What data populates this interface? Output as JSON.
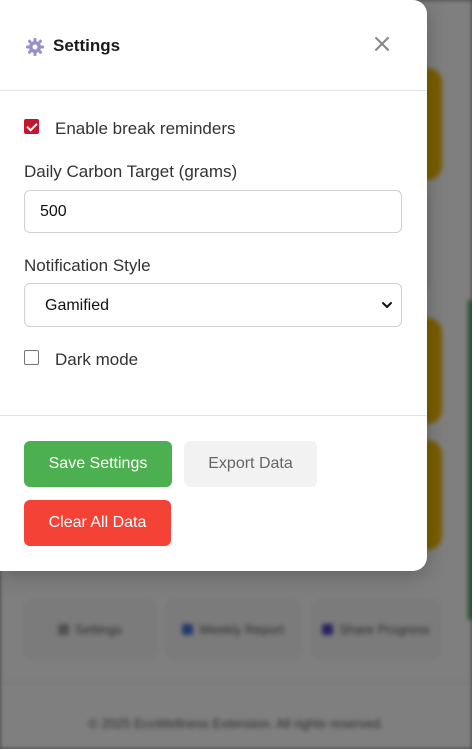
{
  "background": {
    "tiles": [
      {
        "label": "Settings",
        "icon": "gear-icon"
      },
      {
        "label": "Weekly Report",
        "icon": "chart-icon"
      },
      {
        "label": "Share Progress",
        "icon": "share-icon"
      }
    ],
    "footer_text": "© 2025 EcoWellness Extension. All rights reserved."
  },
  "modal": {
    "title": "Settings",
    "title_icon": "gear-icon",
    "close_glyph": "×",
    "break_reminders": {
      "label": "Enable break reminders",
      "checked": true
    },
    "carbon_target": {
      "label": "Daily Carbon Target (grams)",
      "value": "500"
    },
    "notification_style": {
      "label": "Notification Style",
      "selected": "Gamified"
    },
    "dark_mode": {
      "label": "Dark mode",
      "checked": false
    },
    "buttons": {
      "save": "Save Settings",
      "export": "Export Data",
      "clear": "Clear All Data"
    }
  },
  "colors": {
    "save": "#4caf50",
    "clear": "#f44336",
    "checkbox_checked": "#c5152d",
    "background_card_gold": "#e8b400"
  }
}
